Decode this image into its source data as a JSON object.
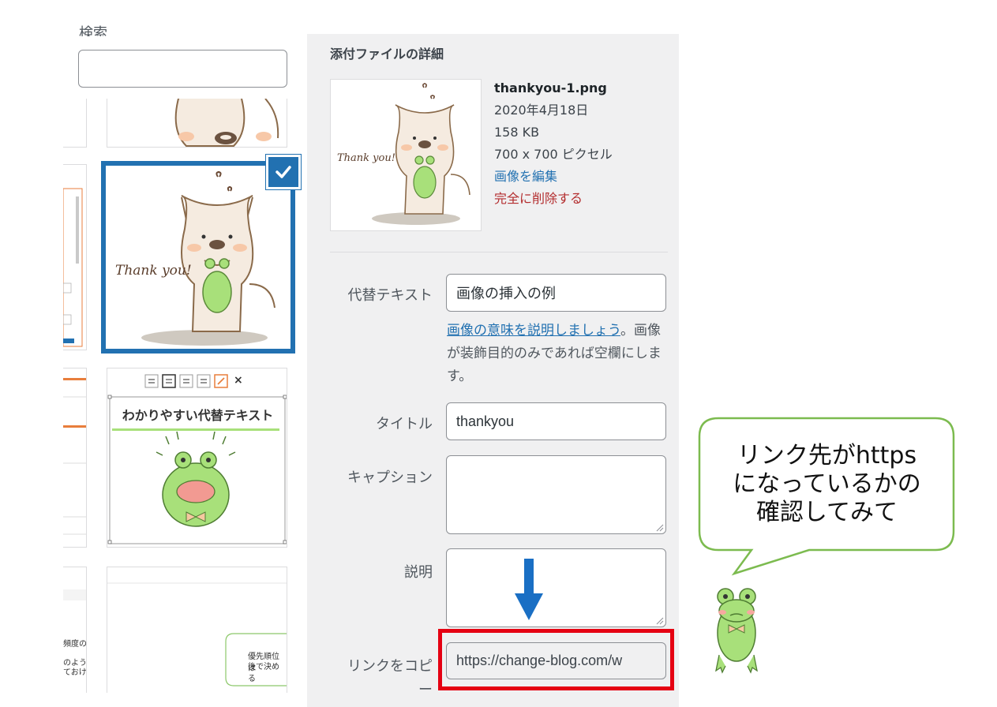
{
  "sidebar": {
    "search_label": "検索",
    "search_value": "",
    "thumb4": {
      "toolbar_close": "×",
      "heading": "わかりやすい代替テキスト"
    },
    "thumb6": {
      "bubble_line1": "優先順位は",
      "bubble_line2": "後で決める"
    }
  },
  "details": {
    "title": "添付ファイルの詳細",
    "filename": "thankyou-1.png",
    "date": "2020年4月18日",
    "size": "158 KB",
    "dimensions": "700 x 700 ピクセル",
    "edit_label": "画像を編集",
    "delete_label": "完全に削除する",
    "preview_caption": "Thank you!"
  },
  "fields": {
    "alt_label": "代替テキスト",
    "alt_value": "画像の挿入の例",
    "alt_help_link": "画像の意味を説明しましょう",
    "alt_help_rest": "。画像が装飾目的のみであれば空欄にします。",
    "title_label": "タイトル",
    "title_value": "thankyou",
    "caption_label": "キャプション",
    "caption_value": "",
    "description_label": "説明",
    "description_value": "",
    "copy_link_label": "リンクをコピー",
    "copy_link_value": "https://change-blog.com/w"
  },
  "annotation": {
    "bubble_line1": "リンク先がhttps",
    "bubble_line2": "になっているかの",
    "bubble_line3": "確認してみて",
    "arrow_color": "#1a6fc4",
    "highlight_color": "#e50012",
    "bubble_border": "#7cbb4f"
  },
  "icons": [
    "check-icon",
    "align-left-icon",
    "align-center-icon",
    "align-right-icon",
    "align-none-icon",
    "edit-pencil-icon",
    "close-icon",
    "resize-handle-icon",
    "down-arrow-icon",
    "frog-illustration",
    "dog-illustration"
  ]
}
